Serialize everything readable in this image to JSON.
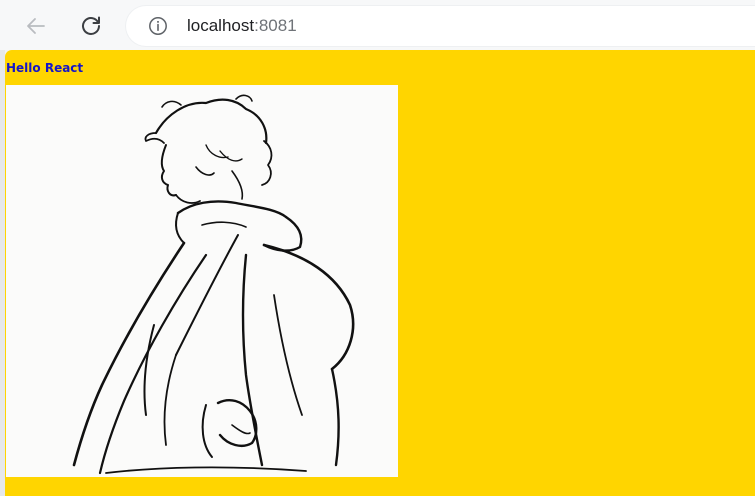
{
  "browser": {
    "url": {
      "host": "localhost",
      "port": ":8081"
    },
    "icons": {
      "back": "back-arrow-icon",
      "reload": "reload-icon",
      "site_info": "info-icon"
    }
  },
  "page": {
    "background_color": "#ffd500",
    "heading": "Hello React",
    "heading_color": "#1515c8",
    "image": {
      "subject": "line-art-person-illustration"
    }
  }
}
